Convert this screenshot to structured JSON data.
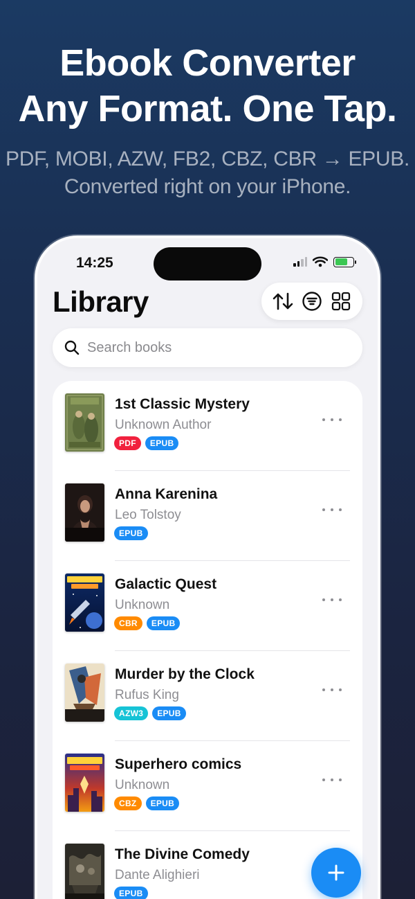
{
  "hero": {
    "title_line1": "Ebook Converter",
    "title_line2": "Any Format. One Tap.",
    "subtitle_line1": "PDF, MOBI, AZW, FB2, CBZ, CBR → EPUB.",
    "subtitle_line2": "Converted right on your iPhone."
  },
  "status_bar": {
    "time": "14:25"
  },
  "header": {
    "title": "Library"
  },
  "search": {
    "placeholder": "Search books"
  },
  "colors": {
    "accent": "#1a8cf5",
    "tag_pdf": "#f1213e",
    "tag_epub": "#1a8cf5",
    "tag_cbr": "#ff8a00",
    "tag_azw3": "#16c3d6",
    "tag_cbz": "#ff8a00"
  },
  "books": [
    {
      "title": "1st Classic Mystery",
      "author": "Unknown Author",
      "tags": [
        {
          "label": "PDF",
          "color": "#f1213e"
        },
        {
          "label": "EPUB",
          "color": "#1a8cf5"
        }
      ],
      "cover": "green-vintage"
    },
    {
      "title": "Anna Karenina",
      "author": "Leo Tolstoy",
      "tags": [
        {
          "label": "EPUB",
          "color": "#1a8cf5"
        }
      ],
      "cover": "dark-portrait",
      "cover_text": "ANNA KARENINA"
    },
    {
      "title": "Galactic Quest",
      "author": "Unknown",
      "tags": [
        {
          "label": "CBR",
          "color": "#ff8a00"
        },
        {
          "label": "EPUB",
          "color": "#1a8cf5"
        }
      ],
      "cover": "space",
      "cover_text": "GALACTIC QUEST"
    },
    {
      "title": "Murder by the Clock",
      "author": "Rufus King",
      "tags": [
        {
          "label": "AZW3",
          "color": "#16c3d6"
        },
        {
          "label": "EPUB",
          "color": "#1a8cf5"
        }
      ],
      "cover": "art-deco",
      "cover_text": "MURDER BY THE CLOCK"
    },
    {
      "title": "Superhero comics",
      "author": "Unknown",
      "tags": [
        {
          "label": "CBZ",
          "color": "#ff8a00"
        },
        {
          "label": "EPUB",
          "color": "#1a8cf5"
        }
      ],
      "cover": "comic",
      "cover_text": "SUPERHERO ADVENTURE"
    },
    {
      "title": "The Divine Comedy",
      "author": "Dante Alighieri",
      "tags": [
        {
          "label": "EPUB",
          "color": "#1a8cf5"
        }
      ],
      "cover": "engraving",
      "cover_text": "THE DIVINE COMEDY"
    }
  ],
  "fab": {
    "icon": "plus-icon"
  }
}
